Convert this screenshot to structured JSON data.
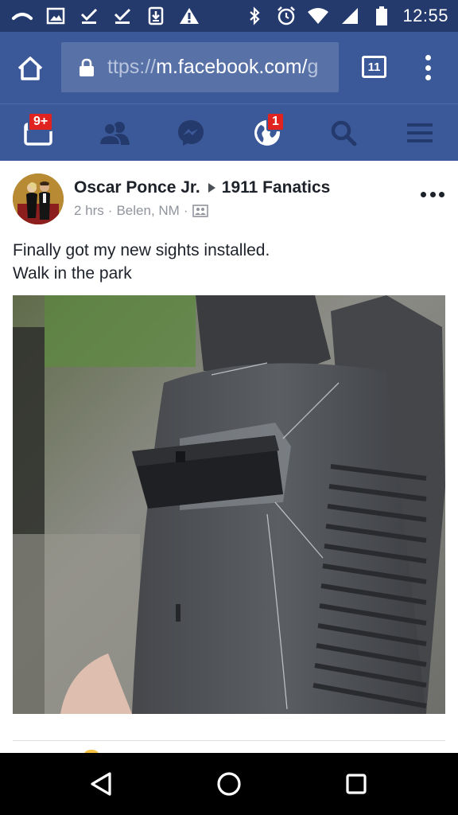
{
  "status_bar": {
    "time": "12:55",
    "left_icons": [
      "cast-icon",
      "image-icon",
      "check-icon",
      "check-icon",
      "download-icon",
      "warning-icon"
    ],
    "right_icons": [
      "bluetooth-icon",
      "alarm-icon",
      "wifi-icon",
      "signal-icon",
      "battery-icon"
    ]
  },
  "browser": {
    "url_prefix": "ttps://",
    "url_host": "m.facebook.com/",
    "url_tail": "g",
    "tab_count": "11"
  },
  "fb_nav": {
    "notifications_badge": "9+",
    "globe_badge": "1"
  },
  "post": {
    "author": "Oscar Ponce Jr.",
    "group": "1911 Fanatics",
    "time": "2 hrs",
    "location": "Belen, NM",
    "separator": "·",
    "text_line1": "Finally got my new sights installed.",
    "text_line2": "Walk in the park"
  },
  "colors": {
    "status_bar": "#253a6c",
    "facebook_blue": "#3b5998",
    "url_field": "#5872a8",
    "badge_red": "#e0231f"
  }
}
